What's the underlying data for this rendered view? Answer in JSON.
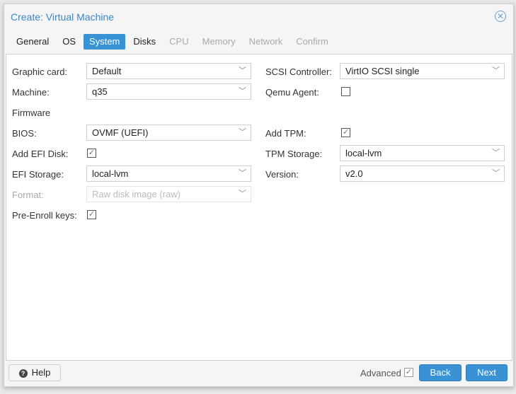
{
  "dialog": {
    "title": "Create: Virtual Machine"
  },
  "tabs": [
    {
      "label": "General",
      "state": "normal"
    },
    {
      "label": "OS",
      "state": "normal"
    },
    {
      "label": "System",
      "state": "active"
    },
    {
      "label": "Disks",
      "state": "normal"
    },
    {
      "label": "CPU",
      "state": "disabled"
    },
    {
      "label": "Memory",
      "state": "disabled"
    },
    {
      "label": "Network",
      "state": "disabled"
    },
    {
      "label": "Confirm",
      "state": "disabled"
    }
  ],
  "left": {
    "graphic_card": {
      "label": "Graphic card:",
      "value": "Default"
    },
    "machine": {
      "label": "Machine:",
      "value": "q35"
    },
    "firmware": "Firmware",
    "bios": {
      "label": "BIOS:",
      "value": "OVMF (UEFI)"
    },
    "add_efi": {
      "label": "Add EFI Disk:",
      "checked": true
    },
    "efi_storage": {
      "label": "EFI Storage:",
      "value": "local-lvm"
    },
    "format": {
      "label": "Format:",
      "value": "Raw disk image (raw)"
    },
    "pre_enroll": {
      "label": "Pre-Enroll keys:",
      "checked": true
    }
  },
  "right": {
    "scsi": {
      "label": "SCSI Controller:",
      "value": "VirtIO SCSI single"
    },
    "qemu_agent": {
      "label": "Qemu Agent:",
      "checked": false
    },
    "add_tpm": {
      "label": "Add TPM:",
      "checked": true
    },
    "tpm_storage": {
      "label": "TPM Storage:",
      "value": "local-lvm"
    },
    "version": {
      "label": "Version:",
      "value": "v2.0"
    }
  },
  "footer": {
    "help": "Help",
    "advanced": "Advanced",
    "advanced_checked": true,
    "back": "Back",
    "next": "Next"
  },
  "colors": {
    "accent": "#3892d4",
    "title": "#3a86c8"
  }
}
